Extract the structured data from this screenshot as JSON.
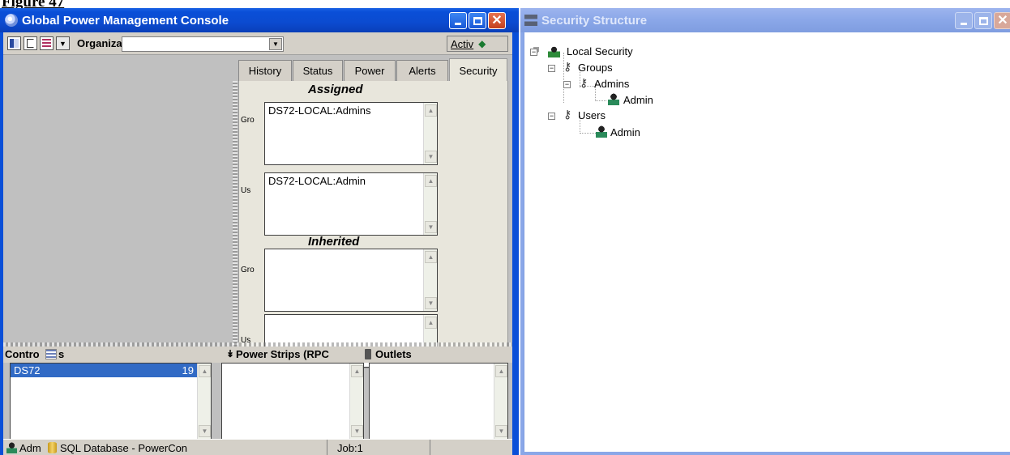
{
  "figure_caption": "Figure 47",
  "gpm_window": {
    "title": "Global Power Management Console",
    "toolbar": {
      "organization_label": "Organiza",
      "organization_value": "",
      "active_label": "Activ"
    },
    "tabs": [
      "History",
      "Status",
      "Power",
      "Alerts",
      "Security"
    ],
    "security": {
      "assigned_heading": "Assigned",
      "inherited_heading": "Inherited",
      "assigned_groups_label": "Gro",
      "assigned_groups_items": [
        "DS72-LOCAL:Admins"
      ],
      "assigned_users_label": "Us",
      "assigned_users_items": [
        "DS72-LOCAL:Admin"
      ],
      "inherited_groups_label": "Gro",
      "inherited_users_label": "Us"
    },
    "bottom_panes": {
      "controllers_label": "Contro",
      "controllers_label_suffix": "s",
      "power_strips_label": "Power Strips (RPC",
      "outlets_label": "Outlets",
      "controllers_items": [
        {
          "name": "DS72",
          "value": "19"
        }
      ]
    },
    "status_bar": {
      "user": "Adm",
      "database": "SQL Database - PowerCon",
      "job": "Job:1"
    }
  },
  "security_window": {
    "title": "Security Structure",
    "tree": {
      "root": "Local Security",
      "groups": "Groups",
      "admins_group": "Admins",
      "admins_member": "Admin",
      "users": "Users",
      "users_member": "Admin"
    }
  },
  "colors": {
    "titlebar_active": "#0b4bd0",
    "titlebar_inactive": "#8aa7e8",
    "close_button": "#c3401e",
    "selection": "#316ac5",
    "panel_gray": "#c0c0c0"
  }
}
